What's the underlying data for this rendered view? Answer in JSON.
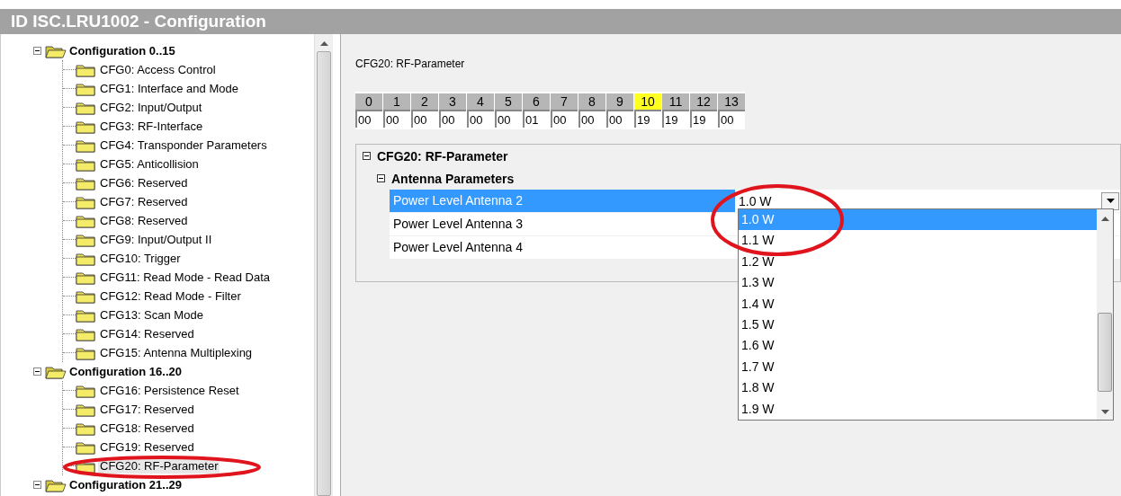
{
  "window": {
    "title": "ID ISC.LRU1002 - Configuration"
  },
  "tree": [
    {
      "label": "Configuration 0..15",
      "expanded": true,
      "children": [
        {
          "label": "CFG0: Access Control",
          "selected": false
        },
        {
          "label": "CFG1: Interface and Mode",
          "selected": false
        },
        {
          "label": "CFG2: Input/Output",
          "selected": false
        },
        {
          "label": "CFG3: RF-Interface",
          "selected": false
        },
        {
          "label": "CFG4: Transponder Parameters",
          "selected": false
        },
        {
          "label": "CFG5: Anticollision",
          "selected": false
        },
        {
          "label": "CFG6: Reserved",
          "selected": false
        },
        {
          "label": "CFG7: Reserved",
          "selected": false
        },
        {
          "label": "CFG8: Reserved",
          "selected": false
        },
        {
          "label": "CFG9: Input/Output II",
          "selected": false
        },
        {
          "label": "CFG10: Trigger",
          "selected": false
        },
        {
          "label": "CFG11: Read Mode - Read Data",
          "selected": false
        },
        {
          "label": "CFG12: Read Mode - Filter",
          "selected": false
        },
        {
          "label": "CFG13: Scan Mode",
          "selected": false
        },
        {
          "label": "CFG14: Reserved",
          "selected": false
        },
        {
          "label": "CFG15: Antenna Multiplexing",
          "selected": false
        }
      ]
    },
    {
      "label": "Configuration 16..20",
      "expanded": true,
      "children": [
        {
          "label": "CFG16: Persistence Reset",
          "selected": false
        },
        {
          "label": "CFG17: Reserved",
          "selected": false
        },
        {
          "label": "CFG18: Reserved",
          "selected": false
        },
        {
          "label": "CFG19: Reserved",
          "selected": false
        },
        {
          "label": "CFG20: RF-Parameter",
          "selected": true
        }
      ]
    },
    {
      "label": "Configuration 21..29",
      "expanded": true
    }
  ],
  "section_title": "CFG20: RF-Parameter",
  "bytes": [
    {
      "index": "0",
      "value": "00",
      "selected": false
    },
    {
      "index": "1",
      "value": "00",
      "selected": false
    },
    {
      "index": "2",
      "value": "00",
      "selected": false
    },
    {
      "index": "3",
      "value": "00",
      "selected": false
    },
    {
      "index": "4",
      "value": "00",
      "selected": false
    },
    {
      "index": "5",
      "value": "00",
      "selected": false
    },
    {
      "index": "6",
      "value": "01",
      "selected": false
    },
    {
      "index": "7",
      "value": "00",
      "selected": false
    },
    {
      "index": "8",
      "value": "00",
      "selected": false
    },
    {
      "index": "9",
      "value": "00",
      "selected": false
    },
    {
      "index": "10",
      "value": "19",
      "selected": true
    },
    {
      "index": "11",
      "value": "19",
      "selected": false
    },
    {
      "index": "12",
      "value": "19",
      "selected": false
    },
    {
      "index": "13",
      "value": "00",
      "selected": false
    }
  ],
  "property_grid": {
    "category": {
      "label": "CFG20: RF-Parameter",
      "expanded": true
    },
    "subcategory": {
      "label": "Antenna Parameters",
      "expanded": true
    },
    "rows": [
      {
        "label": "Power Level Antenna 2",
        "value": "1.0 W",
        "selected": true
      },
      {
        "label": "Power Level Antenna 3",
        "selected": false
      },
      {
        "label": "Power Level Antenna 4",
        "selected": false
      }
    ]
  },
  "dropdown": {
    "options": [
      {
        "label": "1.0 W",
        "selected": true
      },
      {
        "label": "1.1 W",
        "selected": false
      },
      {
        "label": "1.2 W",
        "selected": false
      },
      {
        "label": "1.3 W",
        "selected": false
      },
      {
        "label": "1.4 W",
        "selected": false
      },
      {
        "label": "1.5 W",
        "selected": false
      },
      {
        "label": "1.6 W",
        "selected": false
      },
      {
        "label": "1.7 W",
        "selected": false
      },
      {
        "label": "1.8 W",
        "selected": false
      },
      {
        "label": "1.9 W",
        "selected": false
      }
    ]
  }
}
